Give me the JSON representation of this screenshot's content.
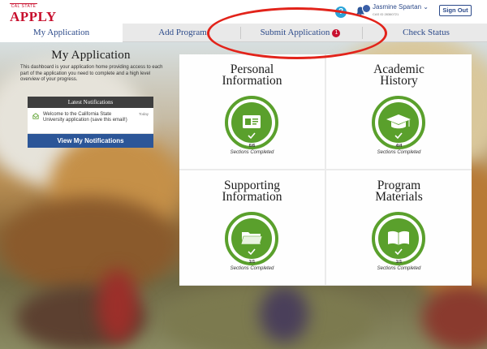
{
  "header": {
    "logo_small": "CAL STATE",
    "logo_big": "APPLY",
    "user_name": "Jasmine Spartan ⌄",
    "user_id": "CAS ID 28360721",
    "help_label": "?",
    "signout_label": "Sign Out"
  },
  "tabs": [
    {
      "label": "My Application",
      "active": true
    },
    {
      "label": "Add Program",
      "active": false
    },
    {
      "label": "Submit Application",
      "active": false,
      "badge": "1"
    },
    {
      "label": "Check Status",
      "active": false
    }
  ],
  "left_panel": {
    "title": "My Application",
    "description": "This dashboard is your application home providing access to each part of the application you need to complete and a high level overview of your progress.",
    "notifications": {
      "heading": "Latest Notifications",
      "items": [
        {
          "text": "Welcome to the California State University application (save this email!)",
          "date": "Today"
        }
      ],
      "button_label": "View My Notifications"
    }
  },
  "cards": [
    {
      "title_line1": "Personal",
      "title_line2": "Information",
      "count": "6/6",
      "label": "Sections Completed",
      "icon": "id-card-icon"
    },
    {
      "title_line1": "Academic",
      "title_line2": "History",
      "count": "4/4",
      "label": "Sections Completed",
      "icon": "graduation-cap-icon"
    },
    {
      "title_line1": "Supporting",
      "title_line2": "Information",
      "count": "1/1",
      "label": "Sections Completed",
      "icon": "folder-icon"
    },
    {
      "title_line1": "Program",
      "title_line2": "Materials",
      "count": "1/1",
      "label": "Sections Completed",
      "icon": "book-icon"
    }
  ],
  "colors": {
    "brand_red": "#c8102e",
    "nav_blue": "#2c4a8a",
    "progress_green": "#5aa02c",
    "annotation_red": "#e2231a"
  }
}
